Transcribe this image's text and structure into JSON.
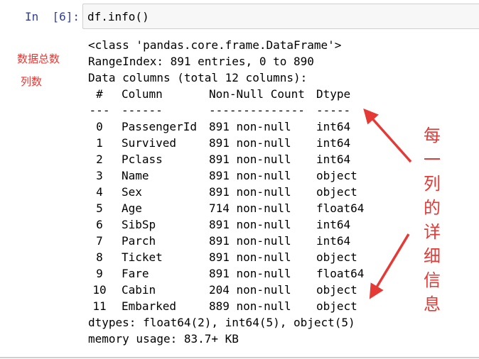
{
  "cell": {
    "prompt": "In  [6]:",
    "code": "df.info()"
  },
  "output": {
    "header_lines": [
      "<class 'pandas.core.frame.DataFrame'>",
      "RangeIndex: 891 entries, 0 to 890",
      "Data columns (total 12 columns):"
    ],
    "table_header": {
      "idx": "#",
      "column": "Column",
      "count": "Non-Null Count",
      "dtype": "Dtype"
    },
    "table_rule": {
      "idx": "---",
      "column": "------",
      "count": "--------------",
      "dtype": "-----"
    },
    "rows": [
      {
        "idx": "0",
        "column": "PassengerId",
        "count": "891 non-null",
        "dtype": "int64"
      },
      {
        "idx": "1",
        "column": "Survived",
        "count": "891 non-null",
        "dtype": "int64"
      },
      {
        "idx": "2",
        "column": "Pclass",
        "count": "891 non-null",
        "dtype": "int64"
      },
      {
        "idx": "3",
        "column": "Name",
        "count": "891 non-null",
        "dtype": "object"
      },
      {
        "idx": "4",
        "column": "Sex",
        "count": "891 non-null",
        "dtype": "object"
      },
      {
        "idx": "5",
        "column": "Age",
        "count": "714 non-null",
        "dtype": "float64"
      },
      {
        "idx": "6",
        "column": "SibSp",
        "count": "891 non-null",
        "dtype": "int64"
      },
      {
        "idx": "7",
        "column": "Parch",
        "count": "891 non-null",
        "dtype": "int64"
      },
      {
        "idx": "8",
        "column": "Ticket",
        "count": "891 non-null",
        "dtype": "object"
      },
      {
        "idx": "9",
        "column": "Fare",
        "count": "891 non-null",
        "dtype": "float64"
      },
      {
        "idx": "10",
        "column": "Cabin",
        "count": "204 non-null",
        "dtype": "object"
      },
      {
        "idx": "11",
        "column": "Embarked",
        "count": "889 non-null",
        "dtype": "object"
      }
    ],
    "footer_lines": [
      "dtypes: float64(2), int64(5), object(5)",
      "memory usage: 83.7+ KB"
    ]
  },
  "annotations": {
    "total_rows_note": "数据总数",
    "columns_note": "列数",
    "per_column_note": "每一列的详细信息",
    "color": "#e53935"
  }
}
